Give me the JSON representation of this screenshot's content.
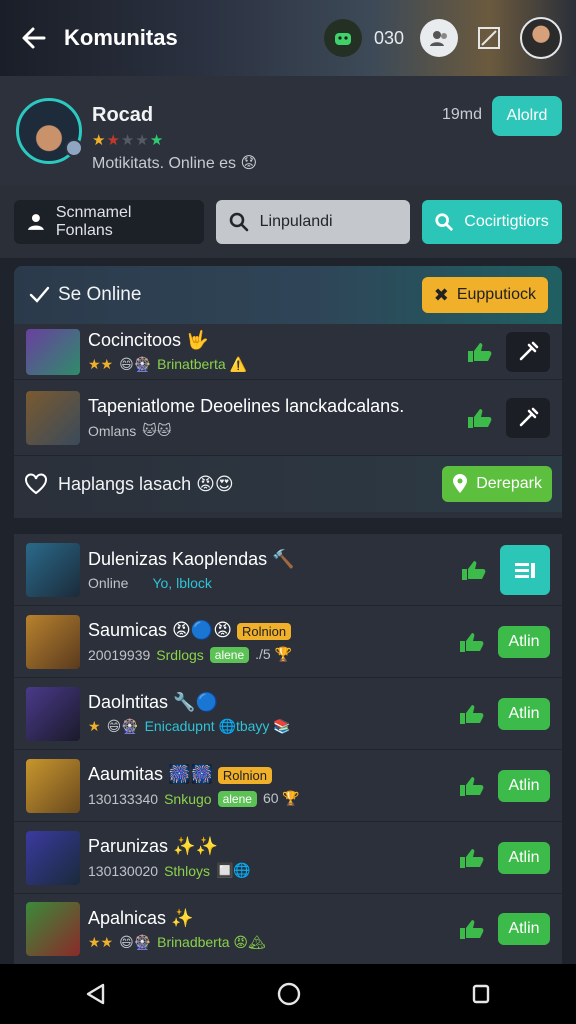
{
  "header": {
    "title": "Komunitas",
    "coin_count": "030"
  },
  "profile": {
    "name": "Rocad",
    "rating": "★★★★★",
    "status": "Motikitats. Online es 😟",
    "time": "19md",
    "button_label": "Alolrd"
  },
  "filters": {
    "chip1": "Scnmamel Fonlans",
    "search_value": "Linpulandi",
    "chip3": "Cocirtigtiors"
  },
  "online_banner": {
    "label": "Se Online",
    "button_label": "Eupputiock"
  },
  "section1": {
    "rows": [
      {
        "title": "Cocincitoos 🤟",
        "stars": "★★",
        "emoji": "😄🎡",
        "sub": "Brinatberta ⚠️"
      },
      {
        "title": "Tapeniatlome Deoelines lanckadcalans.",
        "sub": "Omlans",
        "emoji": "🐱🐱"
      }
    ],
    "fav_label": "Haplangs lasach 😡😍",
    "fav_button": "Derepark"
  },
  "section2": {
    "rows": [
      {
        "title": "Dulenizas Kaoplendas 🔨",
        "sub": "Online",
        "sub2": "Yo, lblock"
      },
      {
        "title": "Saumicas 😡🔵😡",
        "tag": "Rolnion",
        "sub": "20019939",
        "sub2": "Srdlogs",
        "tag2": "alene",
        "extra": "./5 🏆",
        "button": "Atlin"
      },
      {
        "title": "Daolntitas 🔧🔵",
        "stars": "★",
        "emoji": "😄🎡",
        "sub2": "Enicadupnt 🌐tbayy 📚",
        "button": "Atlin"
      },
      {
        "title": "Aaumitas 🎆🎆",
        "tag": "Rolnion",
        "sub": "130133340",
        "sub2": "Snkugo",
        "tag2": "alene",
        "extra": "60 🏆",
        "button": "Atlin"
      },
      {
        "title": "Parunizas ✨✨",
        "sub": "130130020",
        "sub2": "Sthloys",
        "emoji2": "🔲🌐",
        "button": "Atlin"
      },
      {
        "title": "Apalnicas ✨",
        "stars": "★★",
        "emoji": "😄🎡",
        "sub2": "Brinadberta 😡🏔",
        "button": "Atlin"
      }
    ]
  },
  "colors": {
    "accent": "#2cc6b8",
    "action": "#3dbb4a",
    "warning": "#f0b02a"
  }
}
